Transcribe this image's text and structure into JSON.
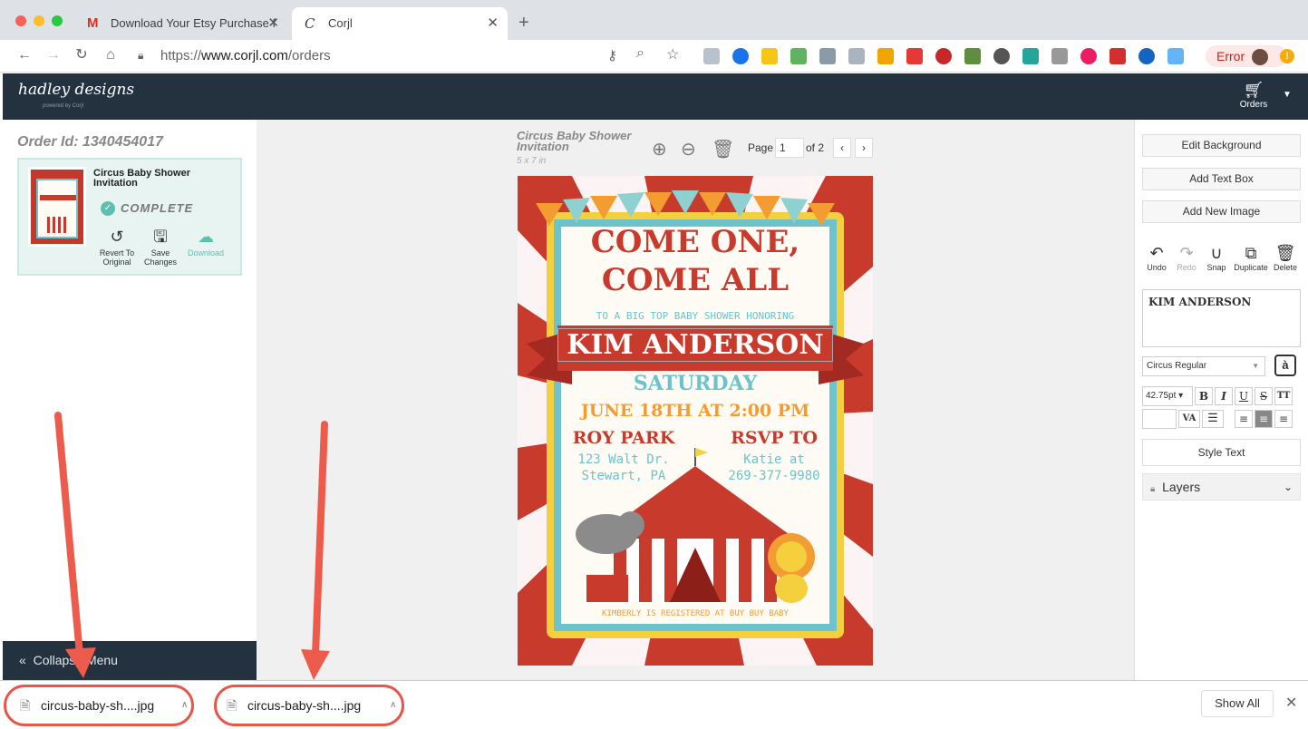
{
  "browser": {
    "tabs": [
      {
        "label": "Download Your Etsy Purchase f"
      },
      {
        "label": "Corjl"
      }
    ],
    "url_prefix": "https://",
    "url_domain": "www.corjl.com",
    "url_path": "/orders",
    "error_label": "Error"
  },
  "app": {
    "logo": "hadley designs",
    "logo_sub": "powered by Corjl",
    "cart_label": "Orders"
  },
  "order": {
    "id": "Order Id: 1340454017",
    "title": "Circus Baby Shower Invitation",
    "status": "COMPLETE",
    "actions": [
      "Revert To Original",
      "Save Changes",
      "Download"
    ],
    "collapse": "Collapse Menu"
  },
  "doc": {
    "title": "Circus Baby Shower Invitation",
    "size": "5 x 7 in",
    "page_label": "Page",
    "page": "1",
    "of": "of 2"
  },
  "invite": {
    "line1": "COME ONE,",
    "line2": "COME ALL",
    "line3": "TO A BIG TOP BABY SHOWER HONORING",
    "name": "KIM ANDERSON",
    "day": "SATURDAY",
    "date": "JUNE 18TH AT 2:00 PM",
    "loc_head": "ROY PARK",
    "loc1": "123 Walt Dr.",
    "loc2": "Stewart, PA",
    "rsvp_head": "RSVP TO",
    "rsvp1": "Katie at",
    "rsvp2": "269-377-9980",
    "registry": "KIMBERLY IS REGISTERED AT BUY BUY BABY"
  },
  "right": {
    "buttons": [
      "Edit Background",
      "Add Text Box",
      "Add New Image"
    ],
    "actions": [
      "Undo",
      "Redo",
      "Snap",
      "Duplicate",
      "Delete"
    ],
    "text_value": "KIM ANDERSON",
    "font": "Circus Regular",
    "size": "42.75pt",
    "style_text": "Style Text",
    "layers": "Layers"
  },
  "downloads": {
    "items": [
      "circus-baby-sh....jpg",
      "circus-baby-sh....jpg"
    ],
    "show_all": "Show All"
  }
}
